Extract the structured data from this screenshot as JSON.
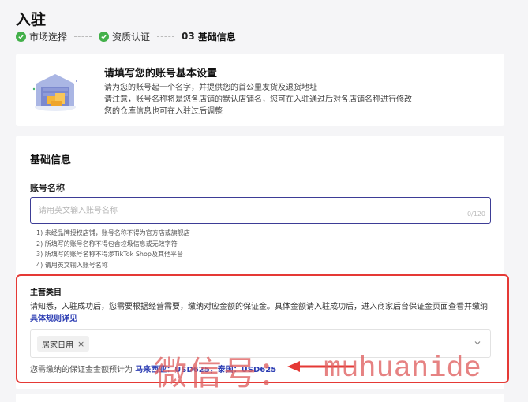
{
  "page": {
    "title": "入驻"
  },
  "steps": [
    {
      "label": "市场选择",
      "status": "done"
    },
    {
      "label": "资质认证",
      "status": "done"
    },
    {
      "number": "03",
      "label": "基础信息",
      "status": "current"
    }
  ],
  "info": {
    "title": "请填写您的账号基本设置",
    "lines": [
      "请为您的账号起一个名字，并提供您的首公里发货及退货地址",
      "请注意，账号名称将是您各店铺的默认店铺名，您可在入驻通过后对各店铺名称进行修改",
      "您的仓库信息也可在入驻过后调整"
    ]
  },
  "form": {
    "section_title": "基础信息",
    "account_label": "账号名称",
    "account_placeholder": "请用英文输入账号名称",
    "account_value": "",
    "counter": "0/120",
    "rules": [
      "1) 未经品牌授权店铺，账号名称不得为官方店或旗舰店",
      "2) 所填写的账号名称不得包含垃圾信息或无效字符",
      "3) 所填写的账号名称不得涉TikTok Shop及其他平台",
      "4) 请用英文输入账号名称"
    ]
  },
  "category": {
    "label": "主营类目",
    "desc": "请知悉，入驻成功后，您需要根据经营需要，缴纳对应金额的保证金。具体金额请入驻成功后，进入商家后台保证金页面查看并缴纳",
    "link": "具体规则详见",
    "selected_tag": "居家日用",
    "deposit_prefix": "您需缴纳的保证金金额预计为",
    "deposit_amount": "马来西亚：USD625，泰国：USD625"
  },
  "watermark": {
    "cn": "微信号：",
    "latin": "muhuanide"
  },
  "colors": {
    "accent": "#2c3db3",
    "success": "#43b04a",
    "highlight": "#e53935"
  },
  "icons": [
    "check-icon",
    "warehouse-illustration",
    "close-icon",
    "chevron-down-icon",
    "arrow-icon"
  ]
}
